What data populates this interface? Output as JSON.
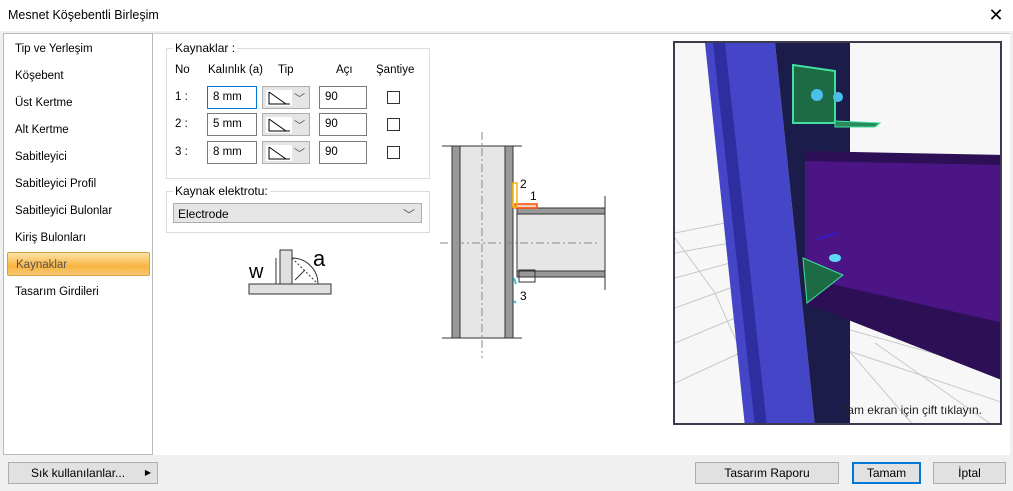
{
  "window": {
    "title": "Mesnet Köşebentli Birleşim",
    "close_icon": "close-icon"
  },
  "sidebar": {
    "items": [
      {
        "label": "Tip ve Yerleşim"
      },
      {
        "label": "Köşebent"
      },
      {
        "label": "Üst Kertme"
      },
      {
        "label": "Alt Kertme"
      },
      {
        "label": "Sabitleyici"
      },
      {
        "label": "Sabitleyici Profil"
      },
      {
        "label": "Sabitleyici Bulonlar"
      },
      {
        "label": "Kiriş Bulonları"
      },
      {
        "label": "Kaynaklar",
        "active": true
      },
      {
        "label": "Tasarım Girdileri"
      }
    ]
  },
  "welds": {
    "legend": "Kaynaklar :",
    "headers": {
      "no": "No",
      "thickness": "Kalınlık (a)",
      "type": "Tip",
      "angle": "Açı",
      "site": "Şantiye"
    },
    "rows": [
      {
        "no": "1 :",
        "thickness": "8 mm",
        "angle": "90",
        "site": false
      },
      {
        "no": "2 :",
        "thickness": "5 mm",
        "angle": "90",
        "site": false
      },
      {
        "no": "3 :",
        "thickness": "8 mm",
        "angle": "90",
        "site": false
      }
    ]
  },
  "electrode": {
    "legend": "Kaynak elektrotu:",
    "value": "Electrode"
  },
  "weld_diagram": {
    "w_label": "w",
    "a_label": "a"
  },
  "section_drawing": {
    "labels": [
      "1",
      "2",
      "3"
    ],
    "colors": {
      "weld1": "#ff4a00",
      "weld2": "#f5b400",
      "weld3": "#3cc8d0"
    }
  },
  "view3d": {
    "hint": "Tam ekran için çift tıklayın."
  },
  "footer": {
    "favorites": "Sık kullanılanlar...",
    "report": "Tasarım Raporu",
    "ok": "Tamam",
    "cancel": "İptal"
  }
}
